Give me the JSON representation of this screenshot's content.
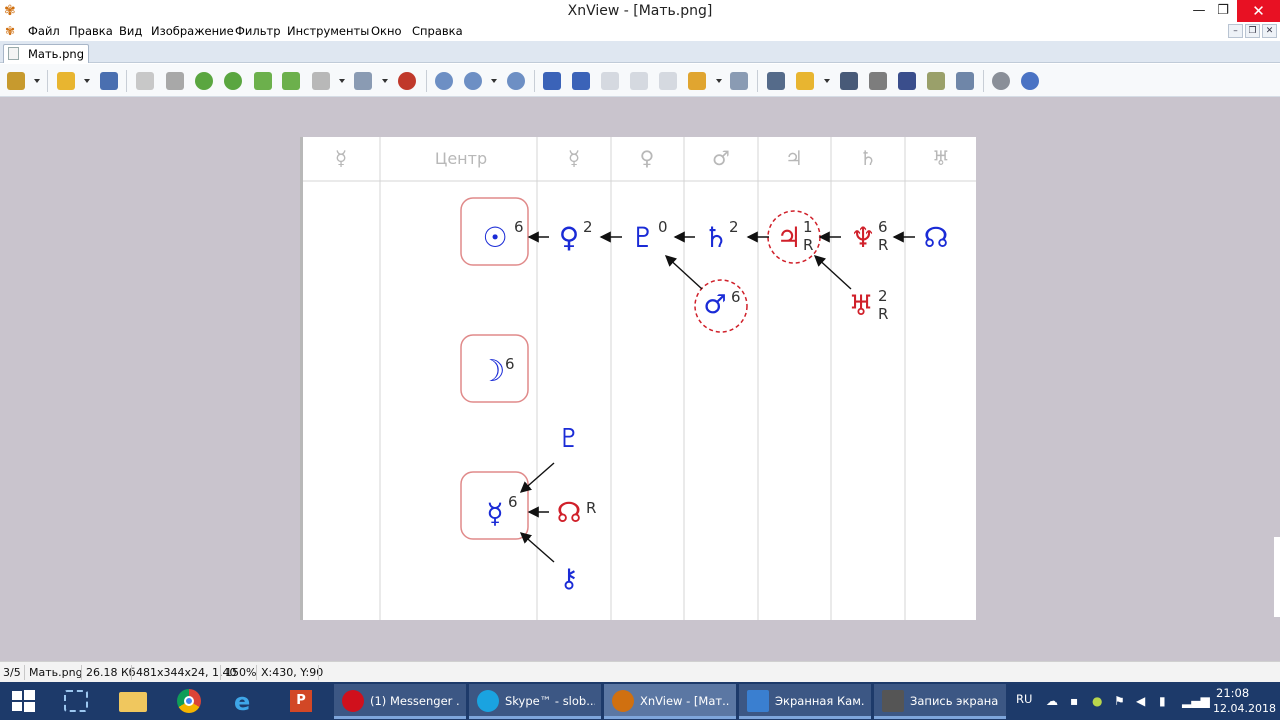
{
  "window": {
    "title": "XnView - [Мать.png]",
    "minimize": "—",
    "maximize": "❐",
    "close": "✕"
  },
  "menu": {
    "items": [
      "Файл",
      "Правка",
      "Вид",
      "Изображение",
      "Фильтр",
      "Инструменты",
      "Окно",
      "Справка"
    ]
  },
  "tab": {
    "label": "Мать.png"
  },
  "toolbar": {
    "icons": [
      "browser-icon",
      "open-folder-icon",
      "save-icon",
      "undo-icon",
      "crop-icon",
      "rotate-left-icon",
      "rotate-right-icon",
      "flip-icon",
      "image-icon",
      "resize-icon",
      "adjust-icon",
      "effects-icon",
      "zoom-in-icon",
      "zoom-icon",
      "zoom-out-icon",
      "previous-icon",
      "next-icon",
      "first-icon",
      "last-icon",
      "copy-icon",
      "slideshow-icon",
      "compare-icon",
      "fullscreen-icon",
      "export-icon",
      "find-icon",
      "print-icon",
      "scanner-icon",
      "capture-icon",
      "wallpaper-icon",
      "settings-icon",
      "info-icon"
    ]
  },
  "image": {
    "column_headers": [
      "☿",
      "Центр",
      "☿",
      "♀",
      "♂",
      "♃",
      "♄",
      "♅"
    ],
    "top_chain": [
      {
        "glyph": "☉",
        "num": "6",
        "r": ""
      },
      {
        "glyph": "♀",
        "num": "2",
        "r": ""
      },
      {
        "glyph": "♇",
        "num": "0",
        "r": ""
      },
      {
        "glyph": "♄",
        "num": "2",
        "r": ""
      },
      {
        "glyph": "♃",
        "num": "1",
        "r": "R"
      },
      {
        "glyph": "♆",
        "num": "6",
        "r": "R"
      },
      {
        "glyph": "☊",
        "num": "",
        "r": ""
      }
    ],
    "mars": {
      "glyph": "♂",
      "num": "6"
    },
    "uranus": {
      "glyph": "♅",
      "num": "2",
      "r": "R"
    },
    "moon": {
      "glyph": "☽",
      "num": "6"
    },
    "mercury": {
      "glyph": "☿",
      "num": "6"
    },
    "pluto_small": {
      "glyph": "♇"
    },
    "node": {
      "glyph": "☊",
      "r": "R"
    },
    "chiron": {
      "glyph": "⚷"
    }
  },
  "status": {
    "index": "3/5",
    "filename": "Мать.png",
    "size": "26.18 Кб",
    "dims": "481x344x24, 1.40",
    "zoom": "150%",
    "coords": "X:430, Y:90"
  },
  "taskbar": {
    "tasks": [
      {
        "label": "(1) Messenger ...",
        "color": "#d0101c"
      },
      {
        "label": "Skype™ - slob...",
        "color": "#1aa3e0"
      },
      {
        "label": "XnView - [Мат...",
        "color": "#d07010"
      },
      {
        "label": "Экранная Кам...",
        "color": "#3a7fd0"
      },
      {
        "label": "Запись экрана",
        "color": "#555555"
      }
    ],
    "lang": "RU",
    "time": "21:08",
    "date": "12.04.2018"
  },
  "colors": {
    "chart_blue": "#1a2bd6",
    "chart_red": "#d0202a",
    "box_border": "#e08a8a",
    "taskbar": "#1d3a6a"
  }
}
